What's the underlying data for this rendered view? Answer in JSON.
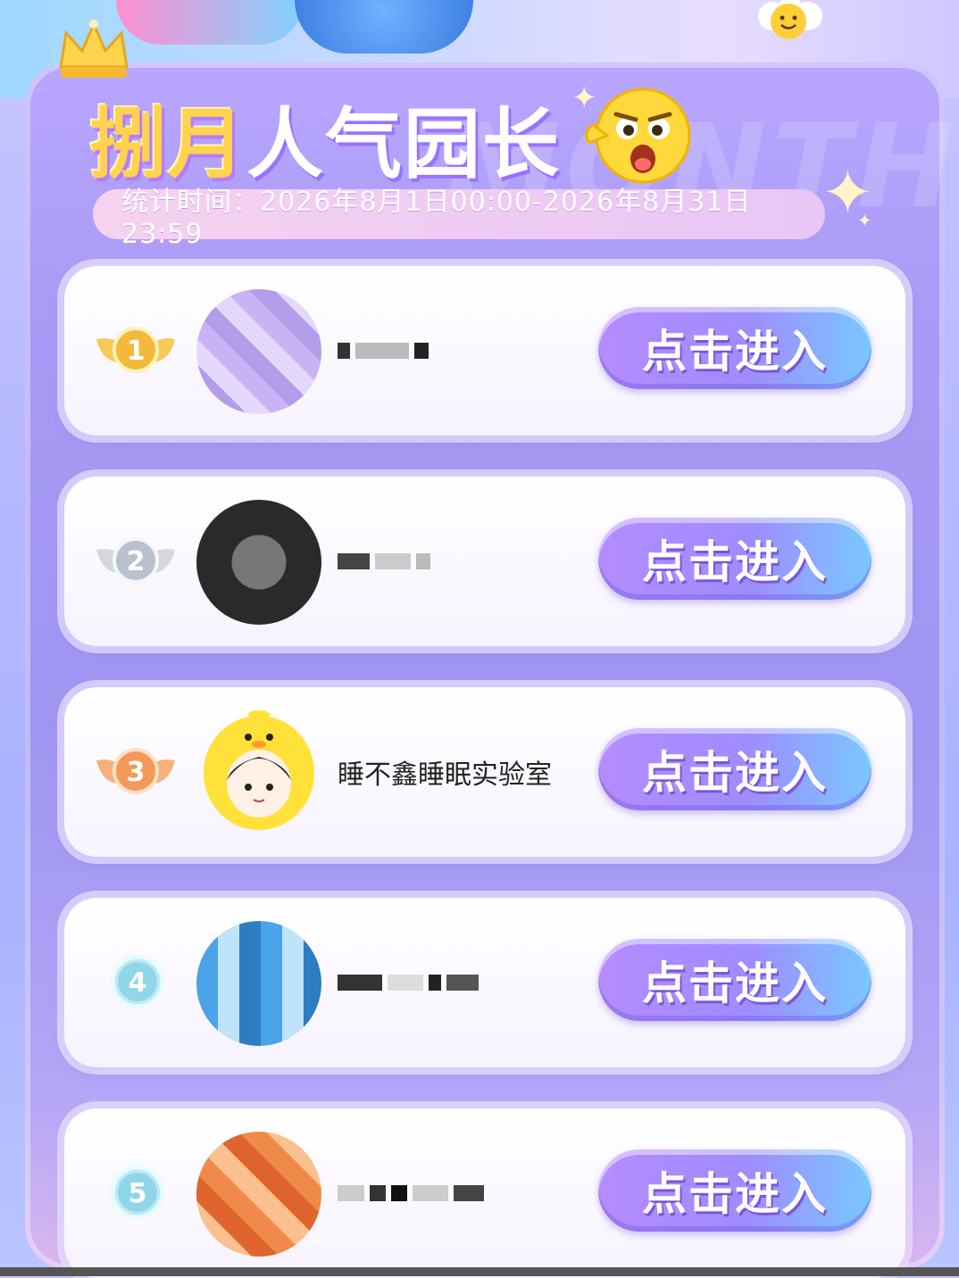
{
  "header": {
    "title_part1": "捌月",
    "title_part2": "人气园长",
    "watermark": "MONTH",
    "stats_period": "统计时间：2026年8月1日00:00-2026年8月31日23:59"
  },
  "ranking": [
    {
      "rank": "1",
      "name": "",
      "button_label": "点击进入",
      "badge_color": "#f2b93b"
    },
    {
      "rank": "2",
      "name": "",
      "button_label": "点击进入",
      "badge_color": "#b9c1cc"
    },
    {
      "rank": "3",
      "name": "睡不鑫睡眠实验室",
      "button_label": "点击进入",
      "badge_color": "#f29a5a"
    },
    {
      "rank": "4",
      "name": "",
      "button_label": "点击进入",
      "badge_color": "#8fd6e8"
    },
    {
      "rank": "5",
      "name": "",
      "button_label": "点击进入",
      "badge_color": "#8fd6e8"
    }
  ],
  "icons": {
    "crown": "crown-icon",
    "emoji": "excited-face-icon",
    "flower": "smiley-flower-icon"
  }
}
